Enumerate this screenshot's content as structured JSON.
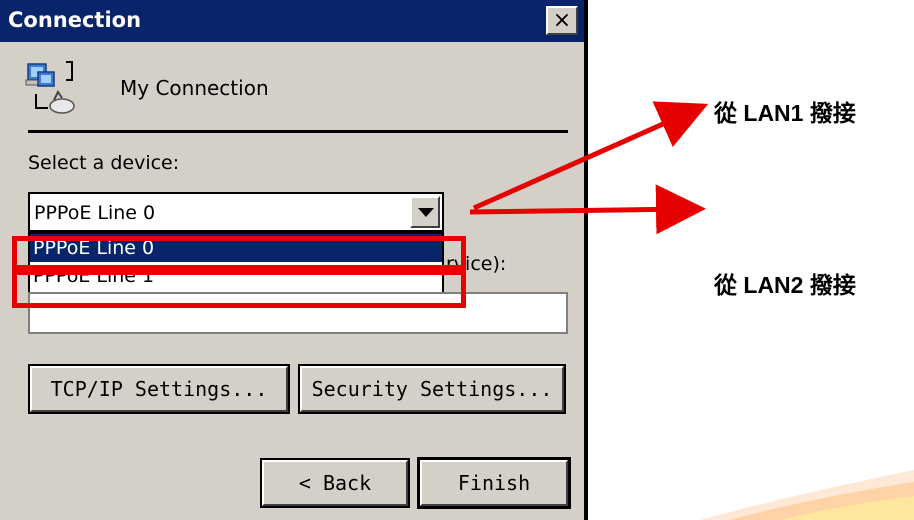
{
  "dialog": {
    "title": "Connection",
    "close_glyph": "×",
    "connection_name": "My Connection",
    "select_device_label": "Select a device:",
    "device_selected": "PPPoE Line 0",
    "device_options": [
      "PPPoE Line 0",
      "PPPoE Line 1"
    ],
    "hidden_label_fragment": "rvice):",
    "tcpip_button": "TCP/IP Settings...",
    "security_button": "Security Settings...",
    "back_button": "< Back",
    "finish_button": "Finish"
  },
  "annotations": {
    "lan1_note": "從 LAN1 撥接",
    "lan2_note": "從 LAN2 撥接",
    "arrow_color": "#e60000",
    "box_color": "#e60000"
  },
  "icons": {
    "connection": "network-computer-icon",
    "close": "close-icon",
    "dropdown": "chevron-down-icon"
  }
}
